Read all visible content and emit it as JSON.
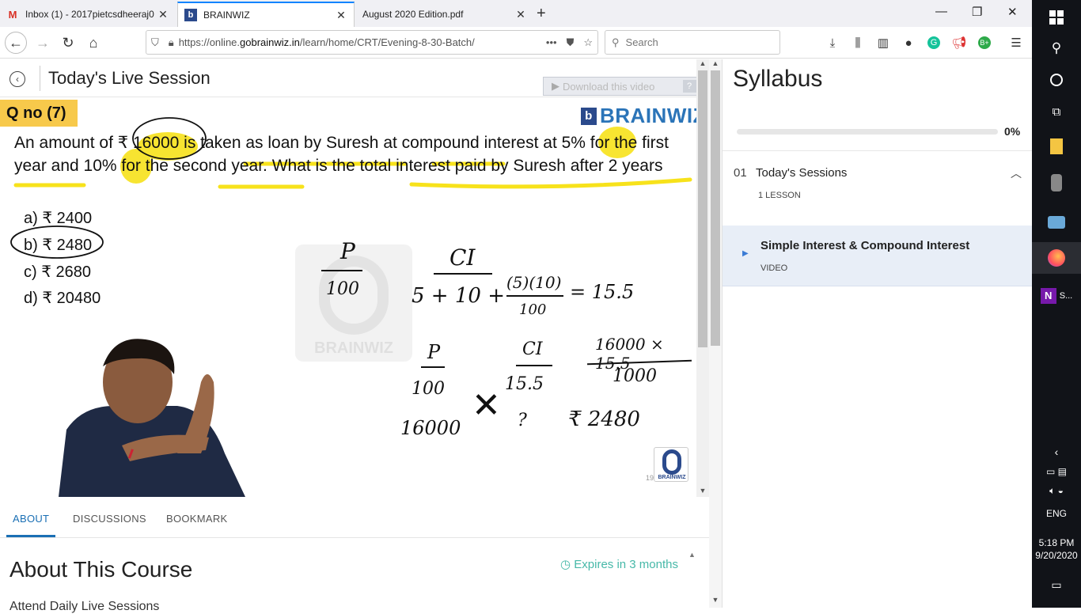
{
  "browser": {
    "tabs": [
      {
        "title": "Inbox (1) - 2017pietcsdheeraj0"
      },
      {
        "title": "BRAINWIZ"
      },
      {
        "title": "August 2020 Edition.pdf"
      }
    ],
    "url_prefix": "https://online.",
    "url_domain": "gobrainwiz.in",
    "url_rest": "/learn/home/CRT/Evening-8-30-Batch/",
    "url_more": "•••",
    "search_placeholder": "Search"
  },
  "page": {
    "title": "Today's Live Session",
    "download_label": "Download this video"
  },
  "video": {
    "qno": "Q no (7)",
    "brand": "BRAINWIZ",
    "question": "An amount of ₹ 16000 is taken as loan by Suresh at compound interest at 5% for the first year and 10% for the second year. What is the total interest paid by Suresh after 2 years",
    "options": [
      "a) ₹ 2400",
      "b) ₹ 2480",
      "c) ₹ 2680",
      "d) ₹ 20480"
    ],
    "watermark": "BRAINWIZ",
    "logo_small_text": "BRAINWIZ",
    "logo_small_num": "19",
    "handwriting": {
      "p1": "P",
      "p1_den": "100",
      "ci": "CI",
      "eq1": "5 + 10 +",
      "frac_num": "(5)(10)",
      "frac_den": "100",
      "eq1_res": "= 15.5",
      "p2": "P",
      "p2_den": "100",
      "ci2": "CI",
      "ci2_val": "15.5",
      "frac2_num": "16000 × 15.5",
      "frac2_den": "1000",
      "row3_left": "16000",
      "row3_mid": "?",
      "row3_res": "₹ 2480"
    }
  },
  "tabs2": {
    "about": "ABOUT",
    "discussions": "DISCUSSIONS",
    "bookmark": "BOOKMARK"
  },
  "about": {
    "title": "About This Course",
    "expires": "Expires in 3 months",
    "text": "Attend Daily Live Sessions"
  },
  "syllabus": {
    "title": "Syllabus",
    "progress_pct": "0%",
    "progress_value": 0.0,
    "section_num": "01",
    "section_title": "Today's Sessions",
    "section_sub": "1 LESSON",
    "lesson_title": "Simple Interest & Compound Interest",
    "lesson_type": "VIDEO"
  },
  "taskbar": {
    "lang": "ENG",
    "time": "5:18 PM",
    "date": "9/20/2020",
    "onenote_label": "S..."
  },
  "colors": {
    "highlight": "#f7e21b",
    "accent": "#1a6fb4",
    "teal": "#2a9d8f"
  }
}
